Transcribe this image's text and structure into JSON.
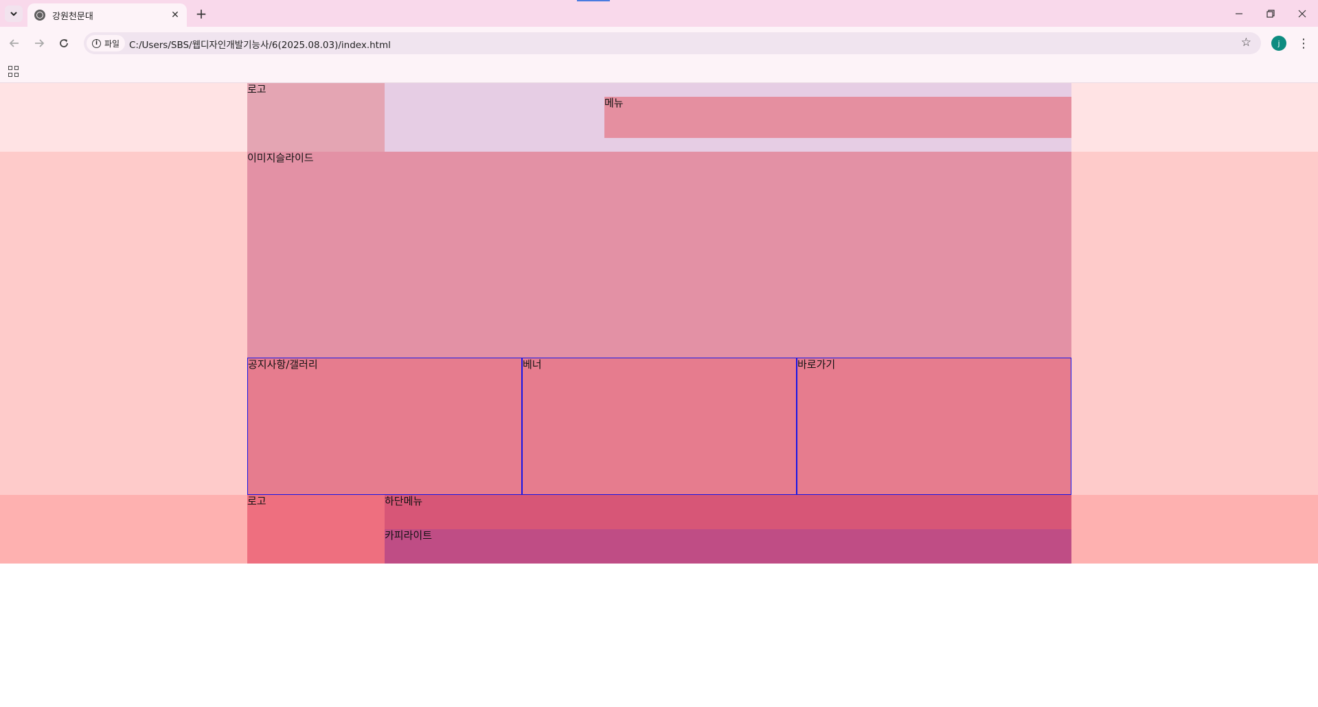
{
  "browser": {
    "tab_title": "강원천문대",
    "tab_close": "✕",
    "new_tab": "+",
    "site_chip_label": "파일",
    "url": "C:/Users/SBS/웹디자인개발기능사/6(2025.08.03)/index.html",
    "profile_initial": "j",
    "icons": [
      "tab-search-icon",
      "globe-icon",
      "close-icon",
      "plus-icon",
      "minimize-icon",
      "restore-icon",
      "close-window-icon",
      "back-icon",
      "forward-icon",
      "reload-icon",
      "info-icon",
      "star-icon",
      "kebab-menu-icon",
      "apps-icon"
    ]
  },
  "page": {
    "header": {
      "logo_label": "로고",
      "menu_label": "메뉴"
    },
    "slide_label": "이미지슬라이드",
    "contents": [
      {
        "label": "공지사항/갤러리"
      },
      {
        "label": "베너"
      },
      {
        "label": "바로가기"
      }
    ],
    "footer": {
      "logo_label": "로고",
      "menu_label": "하단메뉴",
      "copyright_label": "카피라이트"
    }
  },
  "colors": {
    "header_band": "#ffe3e4",
    "main_band": "#fecbca",
    "footer_band": "#feb1b0",
    "logo": "#e4a5b3",
    "nav_area": "#e6cde4",
    "menu": "#e58fa0",
    "slide": "#e391a5",
    "content_box": "#e67c8e",
    "content_border": "#1414e8",
    "footer_logo": "#ee6f7f",
    "footer_menu": "#d75677",
    "copyright": "#bf4d85"
  }
}
